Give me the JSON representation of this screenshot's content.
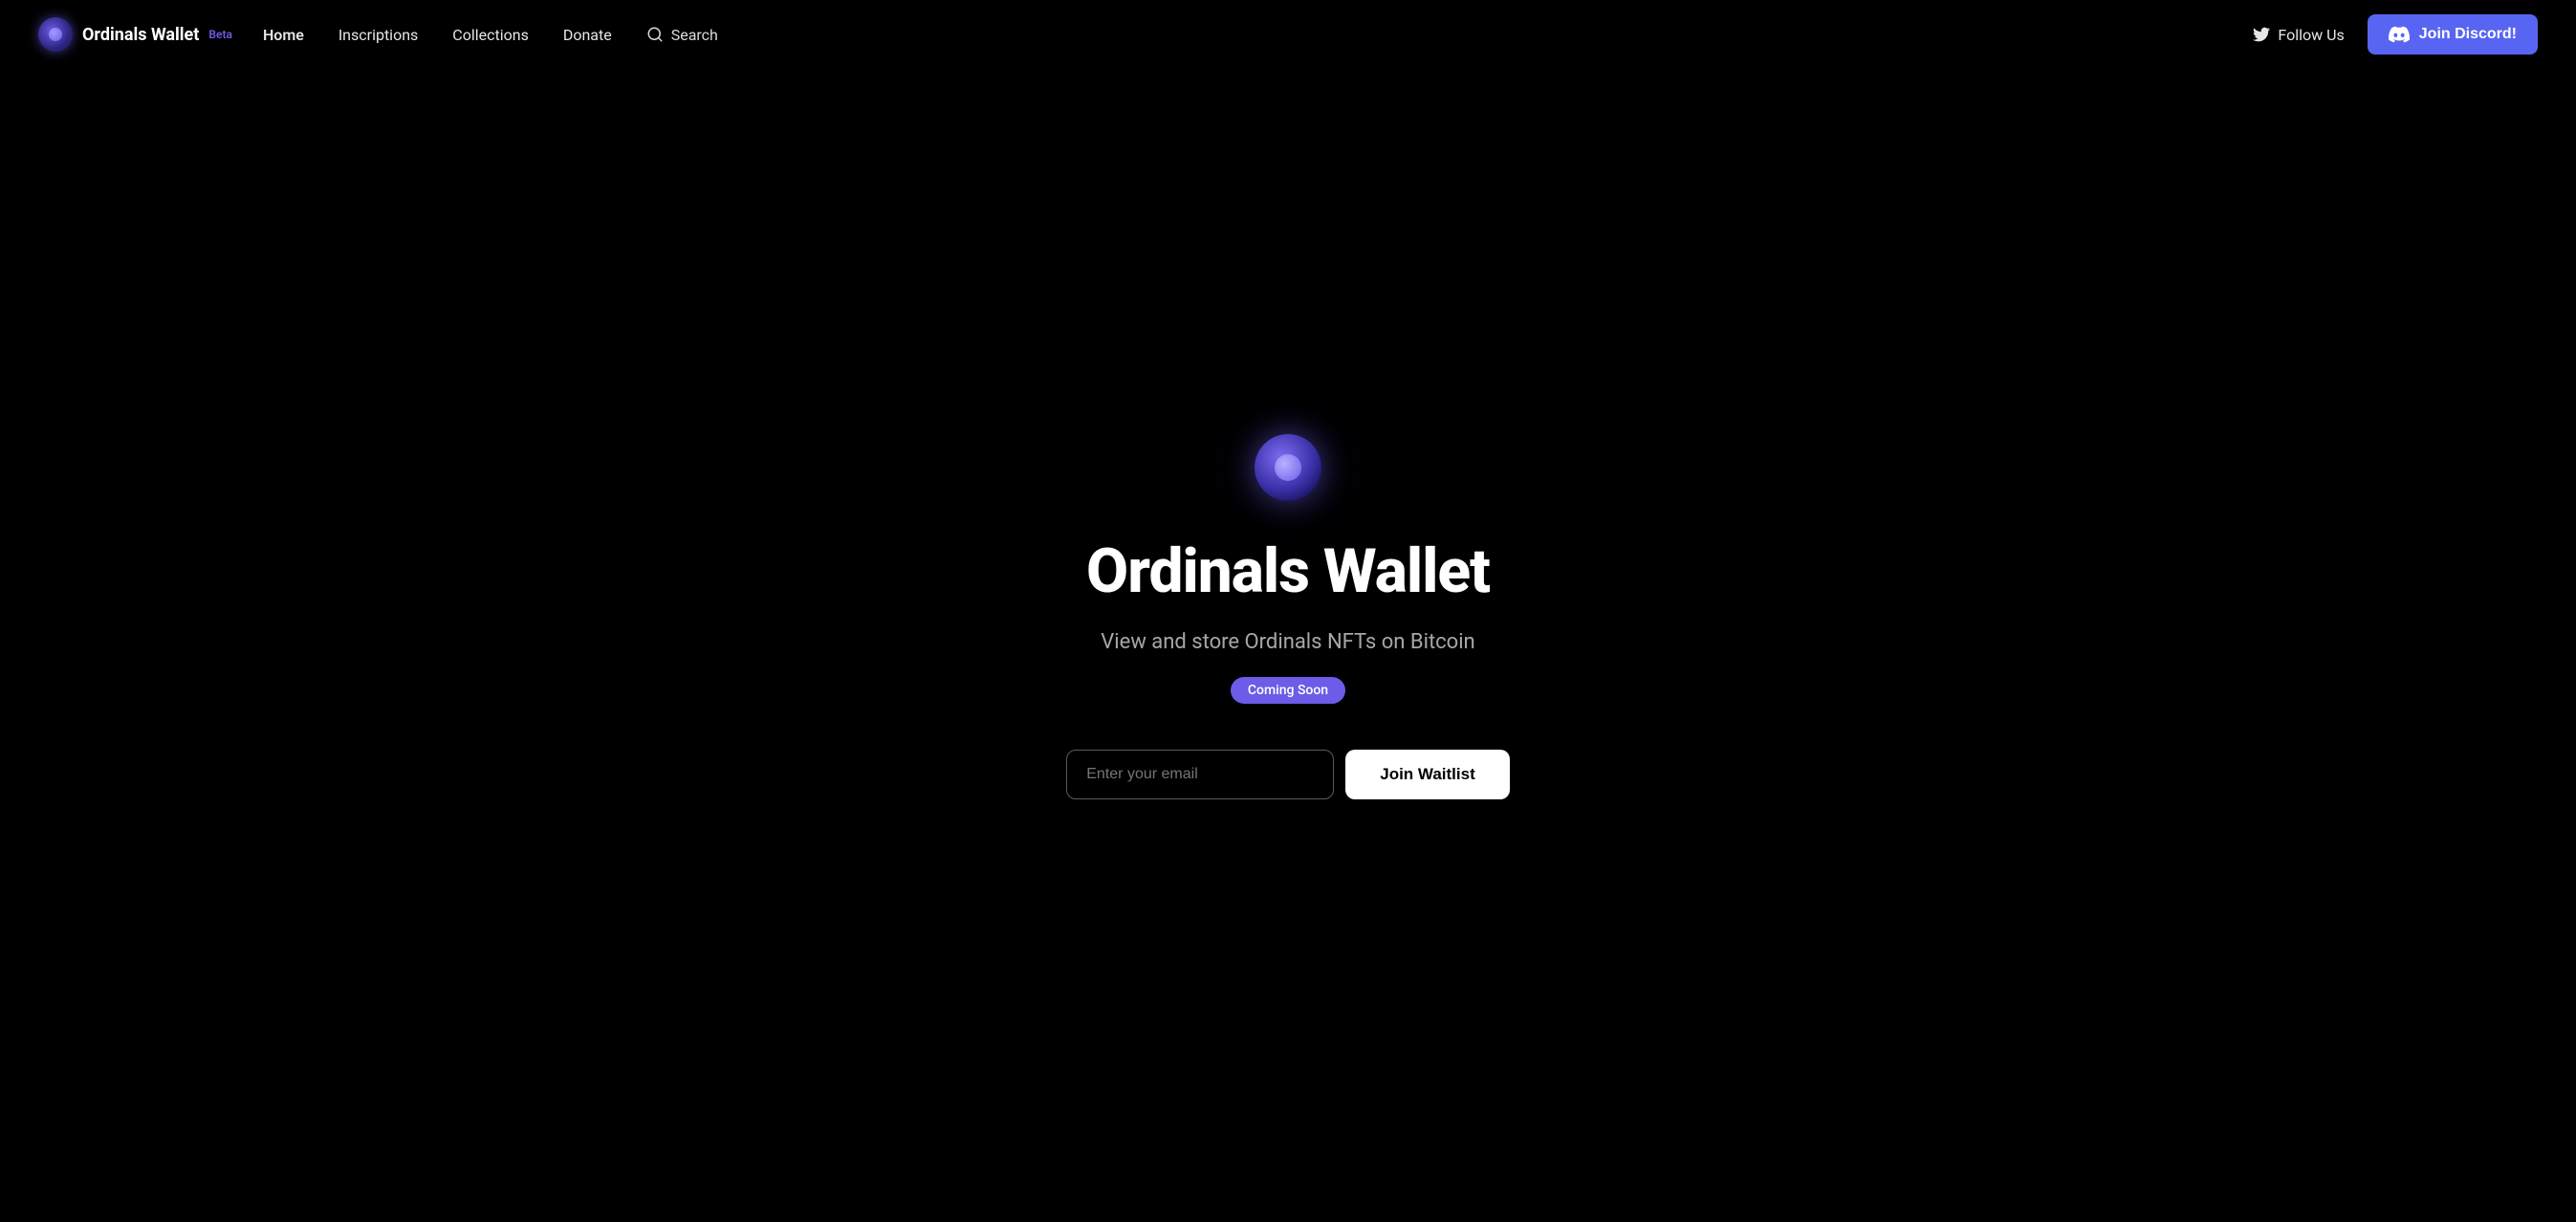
{
  "nav": {
    "logo_text": "Ordinals Wallet",
    "beta_label": "Beta",
    "links": [
      {
        "label": "Home",
        "href": "#"
      },
      {
        "label": "Inscriptions",
        "href": "#"
      },
      {
        "label": "Collections",
        "href": "#"
      },
      {
        "label": "Donate",
        "href": "#"
      }
    ],
    "search_placeholder": "Search",
    "follow_us_label": "Follow Us",
    "discord_btn_label": "Join Discord!"
  },
  "hero": {
    "title": "Ordinals Wallet",
    "subtitle": "View and store Ordinals NFTs on Bitcoin",
    "coming_soon": "Coming Soon",
    "email_placeholder": "Enter your email",
    "waitlist_btn": "Join Waitlist"
  }
}
